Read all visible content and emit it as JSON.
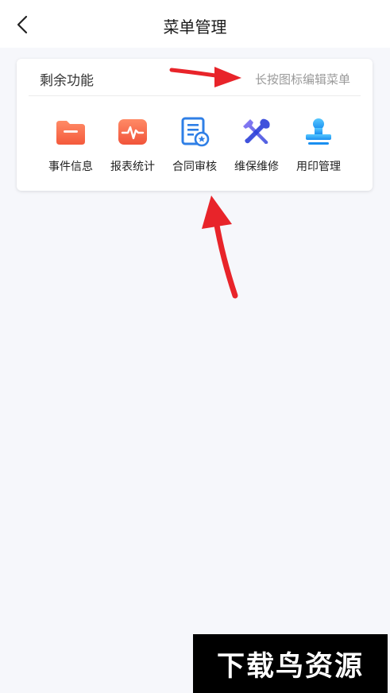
{
  "header": {
    "title": "菜单管理"
  },
  "card": {
    "title": "剩余功能",
    "hint": "长按图标编辑菜单",
    "items": [
      {
        "label": "事件信息",
        "icon": "folder-icon"
      },
      {
        "label": "报表统计",
        "icon": "pulse-chart-icon"
      },
      {
        "label": "合同审核",
        "icon": "contract-review-icon"
      },
      {
        "label": "维保维修",
        "icon": "wrench-screwdriver-icon"
      },
      {
        "label": "用印管理",
        "icon": "stamp-icon"
      }
    ]
  },
  "colors": {
    "accent_red": "#e8242a",
    "icon_orange": "#f86d4b",
    "icon_blue": "#2f7fe6",
    "icon_purple": "#6f63e8",
    "icon_cyan": "#2aa6f2"
  },
  "watermark": {
    "text": "下载鸟资源"
  }
}
